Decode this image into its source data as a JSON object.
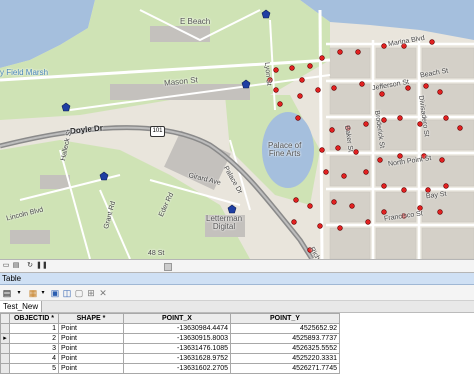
{
  "map": {
    "labels": {
      "e_beach": "E Beach",
      "field_marsh": "y Field Marsh",
      "mason_st": "Mason St",
      "doyle_dr": "Doyle Dr",
      "route_shield": "101",
      "palace": "Palace of\nFine Arts",
      "halleck_st": "Halleck St",
      "lincoln_blvd": "Lincoln Blvd",
      "grant_rd": "Grant Rd",
      "eder_rd": "Eder Rd",
      "girard_ave": "Girard Ave",
      "palace_dr": "Palace Dr",
      "letterman": "Letterman\nDigital",
      "marina_blvd": "Marina Blvd",
      "jefferson_st": "Jefferson St",
      "beach_st": "Beach St",
      "baker_st": "Baker St",
      "broderick_st": "Broderick St",
      "divisadero_st": "Divisadero St",
      "north_point_st": "North Point St",
      "bay_st": "Bay St",
      "francisco_st": "Francisco St",
      "street_48": "48 St",
      "richardson_ave": "Richardson Ave",
      "lyon_st": "Lyon St"
    },
    "colors": {
      "water": "#a5bfdd",
      "park": "#cfe3b5",
      "block": "#d7d2c8",
      "building": "#c4c1bd",
      "road": "#ffffff",
      "highway": "#8a8a8a",
      "point_fill": "#e02020",
      "point_stroke": "#600000",
      "pentagon_fill": "#1f3fa3"
    }
  },
  "viewbar": {
    "icons": [
      "map-view-icon",
      "layout-view-icon",
      "refresh-icon",
      "pause-icon"
    ]
  },
  "table_window": {
    "title": "Table",
    "layer_tab": "Test_New",
    "toolbar_icons": [
      "table-options-icon",
      "related-tables-icon",
      "select-by-attributes-icon",
      "switch-selection-icon",
      "clear-selection-icon",
      "zoom-to-selected-icon",
      "delete-selected-icon"
    ],
    "columns": [
      "OBJECTID *",
      "SHAPE *",
      "POINT_X",
      "POINT_Y"
    ],
    "rows": [
      {
        "objectid": "1",
        "shape": "Point",
        "x": "-13630984.4474",
        "y": "4525652.92"
      },
      {
        "objectid": "2",
        "shape": "Point",
        "x": "-13630915.8003",
        "y": "4525893.7737"
      },
      {
        "objectid": "3",
        "shape": "Point",
        "x": "-13631476.1085",
        "y": "4526325.5552"
      },
      {
        "objectid": "4",
        "shape": "Point",
        "x": "-13631628.9752",
        "y": "4525220.3331"
      },
      {
        "objectid": "5",
        "shape": "Point",
        "x": "-13631602.2705",
        "y": "4526271.7745"
      }
    ],
    "current_row_marker": "▸"
  }
}
